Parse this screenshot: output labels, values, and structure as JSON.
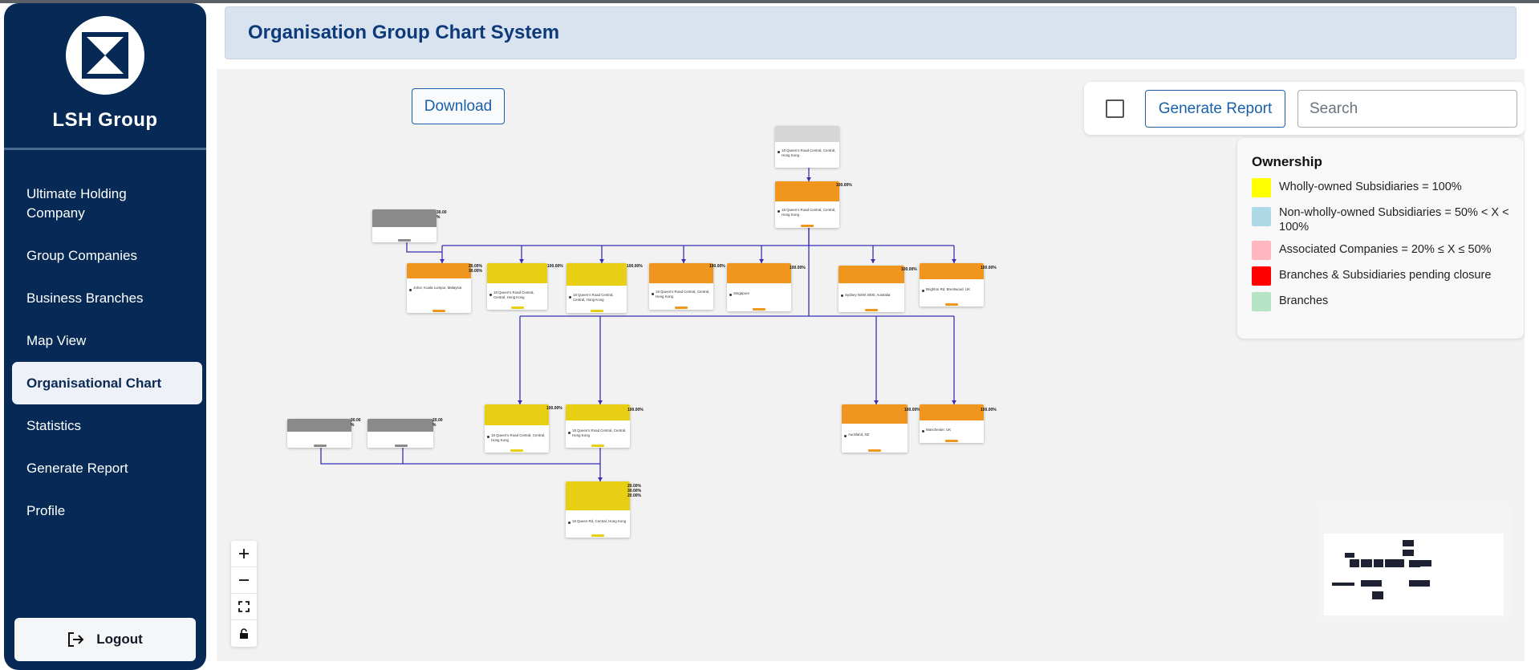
{
  "brand": {
    "name": "LSH Group"
  },
  "header": {
    "title": "Organisation Group Chart System"
  },
  "nav": {
    "items": [
      {
        "label": "Ultimate Holding Company",
        "active": false
      },
      {
        "label": "Group Companies",
        "active": false
      },
      {
        "label": "Business Branches",
        "active": false
      },
      {
        "label": "Map View",
        "active": false
      },
      {
        "label": "Organisational Chart",
        "active": true
      },
      {
        "label": "Statistics",
        "active": false
      },
      {
        "label": "Generate Report",
        "active": false
      },
      {
        "label": "Profile",
        "active": false
      }
    ],
    "logout": "Logout"
  },
  "toolbar": {
    "download": "Download",
    "generate_report": "Generate Report",
    "search_placeholder": "Search"
  },
  "legend": {
    "title": "Ownership",
    "items": [
      {
        "label": "Wholly-owned Subsidiaries = 100%",
        "color": "#ffff00"
      },
      {
        "label": "Non-wholly-owned Subsidiaries = 50% < X < 100%",
        "color": "#add8e6"
      },
      {
        "label": "Associated Companies = 20% ≤ X ≤ 50%",
        "color": "#ffb6c1"
      },
      {
        "label": "Branches & Subsidiaries pending closure",
        "color": "#ff0000"
      },
      {
        "label": "Branches",
        "color": "#b7e4c7"
      }
    ]
  },
  "colors": {
    "sidebar": "#062a55",
    "accent": "#1a5fa8",
    "node_orange": "#f0961e",
    "node_yellow": "#e8cf13",
    "node_grey": "#8a8a8a",
    "node_light": "#d6d6d6",
    "edge": "#3a2fb5"
  },
  "org_chart": {
    "nodes": {
      "n0": {
        "addr": "18 Queen's Road Central, Central, Hong Kong"
      },
      "n1": {
        "addr": "18 Queen's Road Central, Central, Hong Kong",
        "pct": "100.00%"
      },
      "n2": {
        "pct": "30.00 %"
      },
      "n3": {
        "addr": "Johor, Kuala Lumpur, Malaysia",
        "pct": "20.00% 30.00%"
      },
      "n4": {
        "addr": "18 Queen's Road Central, Central, Hong Kong",
        "pct": "100.00%"
      },
      "n5": {
        "addr": "18 Queen's Road Central, Central, Hong Kong",
        "pct": "100.00%"
      },
      "n6": {
        "addr": "18 Queen's Road Central, Central, Hong Kong",
        "pct": "100.00%"
      },
      "n7": {
        "addr": "Singapore",
        "pct": "100.00%"
      },
      "n8": {
        "addr": "Sydney NSW 2000, Australia",
        "pct": "100.00%"
      },
      "n9": {
        "addr": "Brighton Rd, Brentwood, UK",
        "pct": "100.00%"
      },
      "n10": {
        "pct": "30.00 %"
      },
      "n11": {
        "pct": "20.00 %"
      },
      "n12": {
        "addr": "18 Queen's Road Central, Central, Hong Kong",
        "pct": "100.00%"
      },
      "n13": {
        "addr": "18 Queen's Road Central, Central, Hong Kong",
        "pct": "100.00%"
      },
      "n14": {
        "addr": "Auckland, NZ",
        "pct": "100.00%"
      },
      "n15": {
        "addr": "Manchester, UK",
        "pct": "100.00%"
      },
      "n16": {
        "addr": "18 Queen Rd, Central, Hong Kong",
        "pct": "20.00% 30.00% 20.00%"
      }
    }
  }
}
